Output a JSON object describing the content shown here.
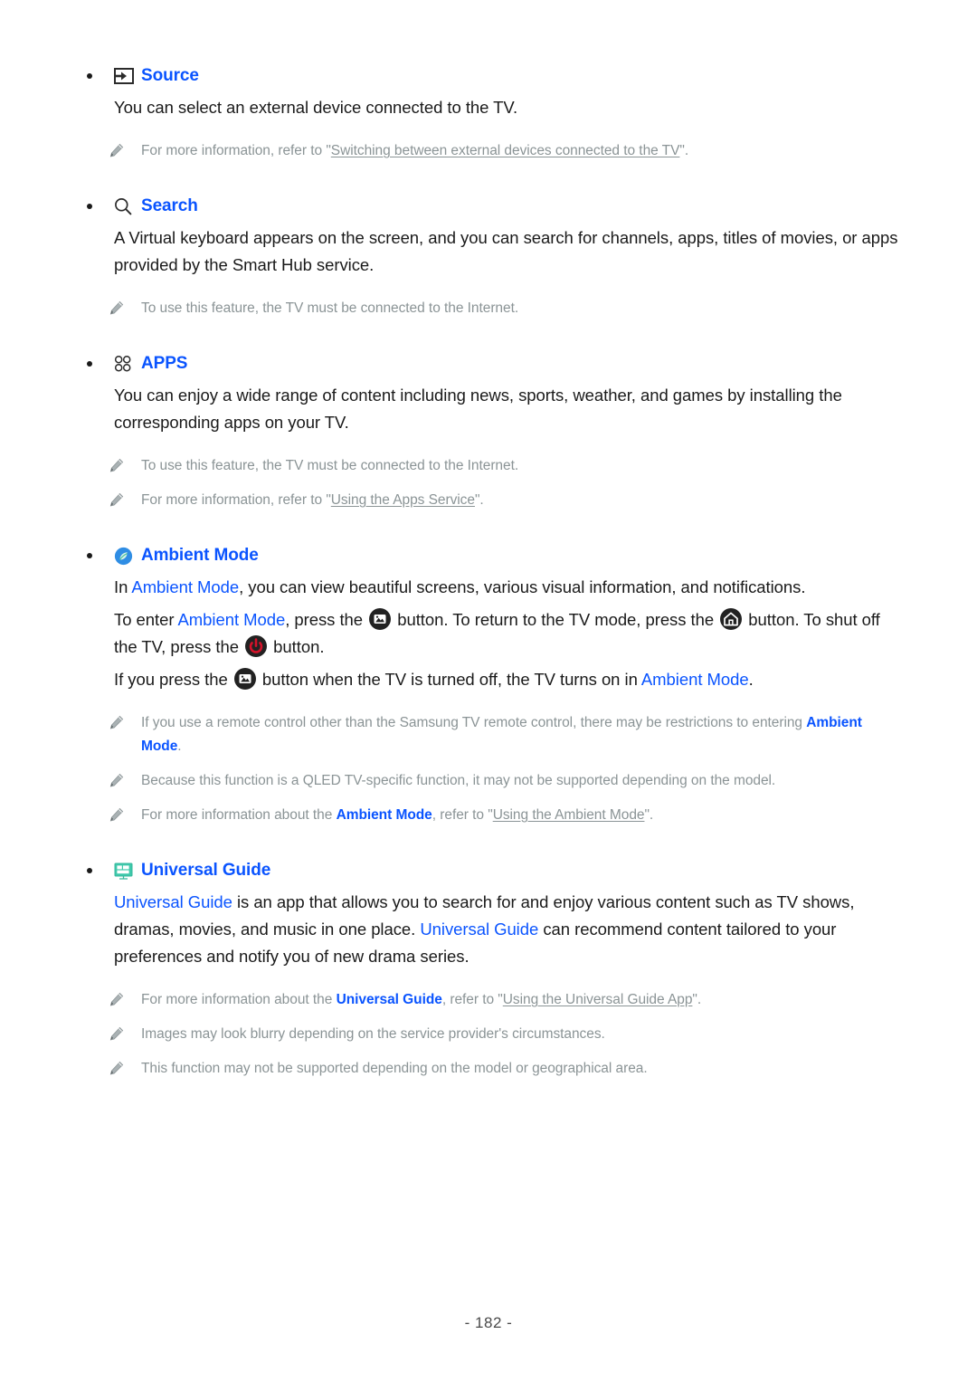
{
  "document": {
    "page_number": "- 182 -"
  },
  "colors": {
    "link_blue": "#0a54ff",
    "note_gray": "#8b9496",
    "body_black": "#1a1a1a",
    "button_black": "#222222",
    "power_red": "#d4122a",
    "ambient_blue": "#2f8de4",
    "guide_teal": "#34c9a3"
  },
  "sections": [
    {
      "id": "source",
      "icon": "source-input-icon",
      "label": "Source",
      "body": "You can select an external device connected to the TV.",
      "notes": [
        {
          "prefix": "For more information, refer to \"",
          "link": "Switching between external devices connected to the TV",
          "suffix": "\"."
        }
      ]
    },
    {
      "id": "search",
      "icon": "search-icon",
      "label": "Search",
      "body": "A Virtual keyboard appears on the screen, and you can search for channels, apps, titles of movies, or apps provided by the Smart Hub service.",
      "notes": [
        {
          "prefix": "To use this feature, the TV must be connected to the Internet.",
          "link": "",
          "suffix": ""
        }
      ]
    },
    {
      "id": "apps",
      "icon": "apps-grid-icon",
      "label": "APPS",
      "body": "You can enjoy a wide range of content including news, sports, weather, and games by installing the corresponding apps on your TV.",
      "notes": [
        {
          "prefix": "To use this feature, the TV must be connected to the Internet.",
          "link": "",
          "suffix": ""
        },
        {
          "prefix": "For more information, refer to \"",
          "link": "Using the Apps Service",
          "suffix": "\"."
        }
      ]
    },
    {
      "id": "ambient-mode",
      "icon": "ambient-mode-icon",
      "label": "Ambient Mode"
    },
    {
      "id": "universal-guide",
      "icon": "universal-guide-icon",
      "label": "Universal Guide"
    }
  ],
  "ambient": {
    "p1_a": "In ",
    "p1_term": "Ambient Mode",
    "p1_b": ", you can view beautiful screens, various visual information, and notifications.",
    "p2_a": "To enter ",
    "p2_term": "Ambient Mode",
    "p2_b": ", press the ",
    "p2_c": " button. To return to the TV mode, press the ",
    "p2_d": " button. To shut off the TV, press the ",
    "p2_e": " button.",
    "p3_a": "If you press the ",
    "p3_b": " button when the TV is turned off, the TV turns on in ",
    "p3_term": "Ambient Mode",
    "p3_c": ".",
    "notes": [
      {
        "prefix": "If you use a remote control other than the Samsung TV remote control, there may be restrictions to entering ",
        "bold_term": "Ambient Mode",
        "suffix": "."
      },
      {
        "prefix": "Because this function is a QLED TV-specific function, it may not be supported depending on the model.",
        "bold_term": "",
        "suffix": ""
      },
      {
        "prefix": "For more information about the ",
        "bold_term": "Ambient Mode",
        "mid": ", refer to \"",
        "link": "Using the Ambient Mode",
        "suffix": "\"."
      }
    ]
  },
  "universal_guide": {
    "p1_term1": "Universal Guide",
    "p1_a": " is an app that allows you to search for and enjoy various content such as TV shows, dramas, movies, and music in one place. ",
    "p1_term2": "Universal Guide",
    "p1_b": " can recommend content tailored to your preferences and notify you of new drama series.",
    "notes": [
      {
        "prefix": "For more information about the ",
        "bold_term": "Universal Guide",
        "mid": ", refer to \"",
        "link": "Using the Universal Guide App",
        "suffix": "\"."
      },
      {
        "prefix": "Images may look blurry depending on the service provider's circumstances.",
        "bold_term": "",
        "mid": "",
        "link": "",
        "suffix": ""
      },
      {
        "prefix": "This function may not be supported depending on the model or geographical area.",
        "bold_term": "",
        "mid": "",
        "link": "",
        "suffix": ""
      }
    ]
  }
}
